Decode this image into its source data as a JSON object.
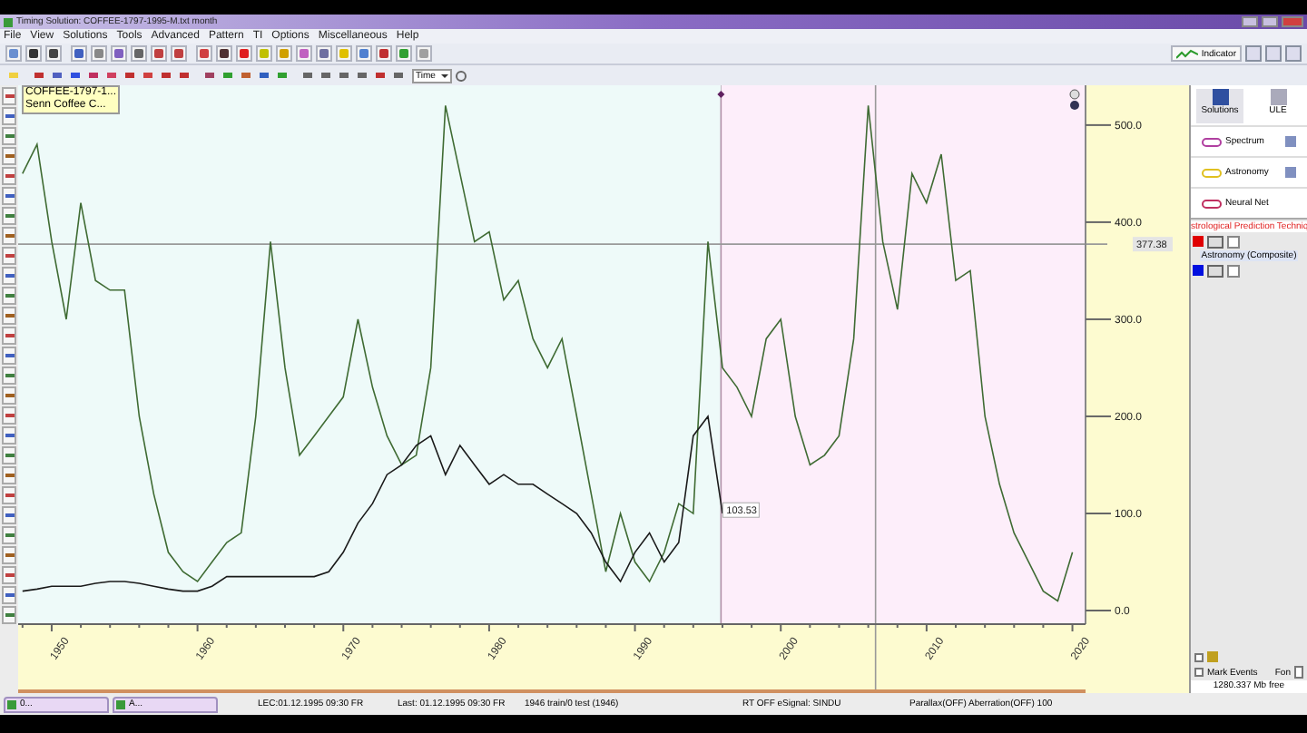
{
  "window": {
    "title": "Timing Solution: COFFEE-1797-1995-M.txt   month"
  },
  "menu": [
    "File",
    "View",
    "Solutions",
    "Tools",
    "Advanced",
    "Pattern",
    "TI",
    "Options",
    "Miscellaneous",
    "Help"
  ],
  "toolbar": {
    "time_dropdown": "Time",
    "indicator_button": "Indicator"
  },
  "tooltip": [
    "COFFEE-1797-1...",
    "Senn Coffee C..."
  ],
  "chart": {
    "cursor_label": "377.38",
    "marker_label": "103.53",
    "chart_data": {
      "type": "line",
      "x": [
        1948,
        1949,
        1950,
        1951,
        1952,
        1953,
        1954,
        1955,
        1956,
        1957,
        1958,
        1959,
        1960,
        1961,
        1962,
        1963,
        1964,
        1965,
        1966,
        1967,
        1968,
        1969,
        1970,
        1971,
        1972,
        1973,
        1974,
        1975,
        1976,
        1977,
        1978,
        1979,
        1980,
        1981,
        1982,
        1983,
        1984,
        1985,
        1986,
        1987,
        1988,
        1989,
        1990,
        1991,
        1992,
        1993,
        1994,
        1995,
        1996,
        1997,
        1998,
        1999,
        2000,
        2001,
        2002,
        2003,
        2004,
        2005,
        2006,
        2007,
        2008,
        2009,
        2010,
        2011,
        2012,
        2013,
        2014,
        2015,
        2016,
        2017,
        2018,
        2019,
        2020
      ],
      "series": [
        {
          "color": "#3f6b33",
          "values": [
            450,
            480,
            380,
            300,
            420,
            340,
            330,
            330,
            200,
            120,
            60,
            40,
            30,
            50,
            70,
            80,
            200,
            380,
            250,
            160,
            180,
            200,
            220,
            300,
            230,
            180,
            150,
            160,
            250,
            520,
            450,
            380,
            390,
            320,
            340,
            280,
            250,
            280,
            200,
            120,
            40,
            100,
            50,
            30,
            60,
            110,
            100,
            380,
            250,
            230,
            200,
            280,
            300,
            200,
            150,
            160,
            180,
            280,
            520,
            380,
            310,
            450,
            420,
            470,
            340,
            350,
            200,
            130,
            80,
            50,
            20,
            10,
            60
          ]
        },
        {
          "color": "#1a1a1a",
          "values": [
            20,
            22,
            25,
            25,
            25,
            28,
            30,
            30,
            28,
            25,
            22,
            20,
            20,
            25,
            35,
            35,
            35,
            35,
            35,
            35,
            35,
            40,
            60,
            90,
            110,
            140,
            150,
            170,
            180,
            140,
            170,
            150,
            130,
            140,
            130,
            130,
            120,
            110,
            100,
            80,
            50,
            30,
            60,
            80,
            50,
            70,
            180,
            200,
            100,
            null,
            null,
            null,
            null,
            null,
            null,
            null,
            null,
            null,
            null,
            null,
            null,
            null,
            null,
            null,
            null,
            null,
            null,
            null,
            null,
            null,
            null,
            null,
            null
          ]
        }
      ],
      "xticks": [
        1960,
        1970,
        1980,
        1990,
        2000,
        2010,
        2020,
        {
          "value": 1950,
          "label": "1950"
        }
      ],
      "yticks": [
        {
          "value": 0,
          "label": "0.0"
        },
        {
          "value": 100,
          "label": "100.0"
        },
        {
          "value": 200,
          "label": "200.0"
        },
        {
          "value": 300,
          "label": "300.0"
        },
        {
          "value": 400,
          "label": "400.0"
        },
        {
          "value": 500,
          "label": "500.0"
        }
      ],
      "xlim": [
        1947.7,
        2020.9
      ],
      "ylim": [
        -14,
        541
      ],
      "bands": [
        {
          "axis": "x",
          "from": 1947.7,
          "to": 1995.9,
          "color": "#eefaf9"
        },
        {
          "axis": "x",
          "from": 1995.9,
          "to": 2020.9,
          "color": "#fdeefa"
        }
      ],
      "ref_lines": [
        {
          "axis": "x",
          "value": 1995.9
        },
        {
          "axis": "x",
          "value": 2006.5
        },
        {
          "axis": "y",
          "value": 377.38
        }
      ]
    }
  },
  "side_panel": {
    "top_buttons": [
      "Solutions",
      "ULE"
    ],
    "modules": [
      "Spectrum",
      "Astronomy",
      "Neural Net"
    ],
    "prediction_header": "strological Prediction Techniq",
    "composite_label": "Astronomy (Composite)",
    "components": [
      {
        "color": "#e00000"
      },
      {
        "color": "#0010e0"
      }
    ],
    "filter_checkbox": {
      "checked": false
    },
    "mark_events": {
      "label": "Mark Events",
      "checked": false
    },
    "font_label": "Fon",
    "memory": "1280.337 Mb free"
  },
  "window_tabs": [
    "0...",
    "A..."
  ],
  "status_bar": [
    "LEC:01.12.1995  09:30 FR",
    "Last: 01.12.1995  09:30 FR",
    "1946 train/0 test (1946)",
    "RT OFF eSignal: SINDU",
    "Parallax(OFF) Aberration(OFF) 100"
  ]
}
